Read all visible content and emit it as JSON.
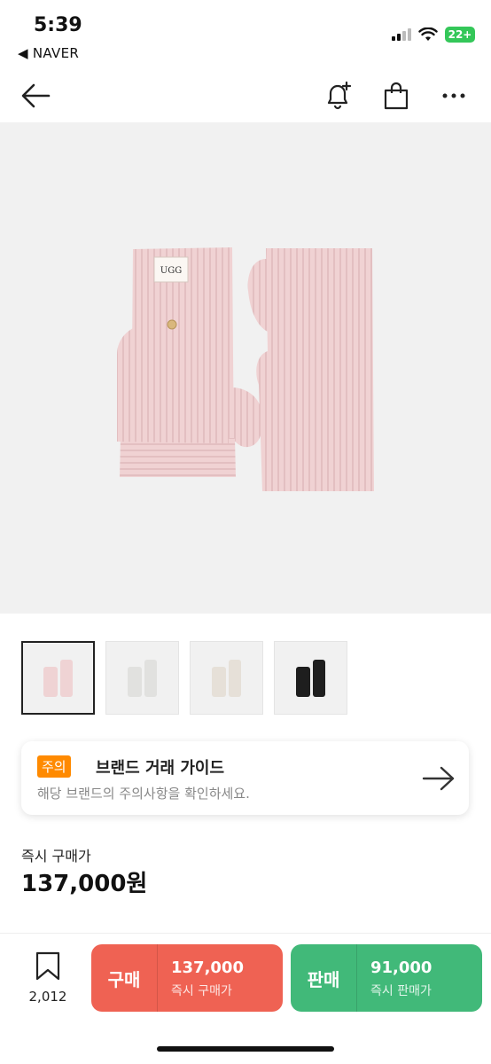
{
  "status": {
    "time": "5:39",
    "back_app": "◀ NAVER",
    "battery": "22+"
  },
  "nav": {
    "back_icon": "arrow-left-icon",
    "icons": [
      "bell-plus-icon",
      "shopping-bag-icon",
      "more-dots-icon"
    ]
  },
  "product": {
    "brand_tag": "UGG",
    "thumbnail_colors": [
      "#efd3d4",
      "#e7e7e5",
      "#ebe6df",
      "#1e1e1e"
    ]
  },
  "guide": {
    "tag": "주의",
    "title": "브랜드 거래 가이드",
    "subtitle": "해당 브랜드의 주의사항을 확인하세요."
  },
  "price": {
    "label": "즉시 구매가",
    "value": "137,000원"
  },
  "bottom": {
    "wish_count": "2,012",
    "buy": {
      "label": "구매",
      "price": "137,000",
      "sub": "즉시 구매가"
    },
    "sell": {
      "label": "판매",
      "price": "91,000",
      "sub": "즉시 판매가"
    }
  },
  "colors": {
    "buy": "#ef6253",
    "sell": "#41b979",
    "caution_tag": "#ff8a00",
    "glove_pink": "#f0d2d3"
  }
}
